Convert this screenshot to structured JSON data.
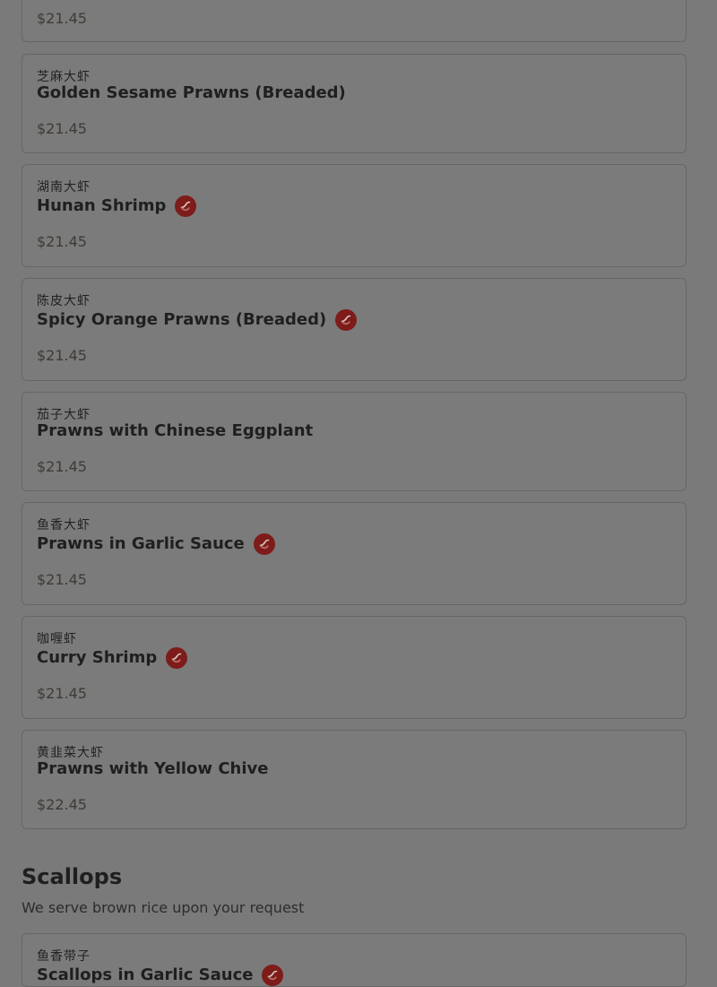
{
  "items": [
    {
      "chinese": "",
      "name": "",
      "price": "$21.45",
      "spicy": false
    },
    {
      "chinese": "芝麻大虾",
      "name": "Golden Sesame Prawns (Breaded)",
      "price": "$21.45",
      "spicy": false
    },
    {
      "chinese": "湖南大虾",
      "name": "Hunan Shrimp",
      "price": "$21.45",
      "spicy": true
    },
    {
      "chinese": "陈皮大虾",
      "name": "Spicy Orange Prawns (Breaded)",
      "price": "$21.45",
      "spicy": true
    },
    {
      "chinese": "茄子大虾",
      "name": "Prawns with Chinese Eggplant",
      "price": "$21.45",
      "spicy": false
    },
    {
      "chinese": "鱼香大虾",
      "name": "Prawns in Garlic Sauce",
      "price": "$21.45",
      "spicy": true
    },
    {
      "chinese": "咖喱虾",
      "name": "Curry Shrimp",
      "price": "$21.45",
      "spicy": true
    },
    {
      "chinese": "黄韭菜大虾",
      "name": "Prawns with Yellow Chive",
      "price": "$22.45",
      "spicy": false
    }
  ],
  "section": {
    "title": "Scallops",
    "subtitle": "We serve brown rice upon your request"
  },
  "partial_bottom_item": {
    "chinese": "鱼香带子",
    "name": "Scallops in Garlic Sauce",
    "spicy": true
  },
  "colors": {
    "overlay_background": "#7a7a7a",
    "card_border": "#666666",
    "spicy_icon": "#7d1c1a"
  },
  "icons": {
    "spicy": "chili-pepper-icon"
  }
}
